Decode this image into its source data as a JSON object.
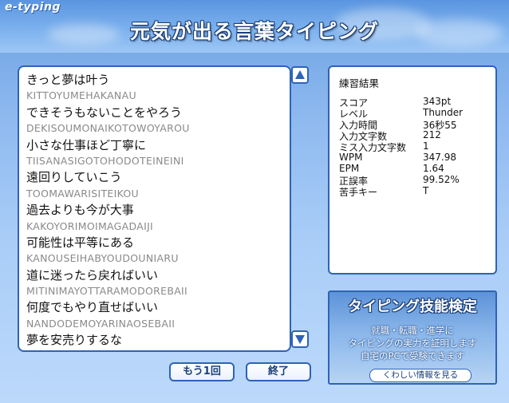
{
  "app": {
    "logo": "e-typing",
    "title": "元気が出る言葉タイピング"
  },
  "text_lines": [
    {
      "jp": "きっと夢は叶う",
      "romaji": "KITTOYUMEHAKANAU"
    },
    {
      "jp": "できそうもないことをやろう",
      "romaji": "DEKISOUMONAIKOTOWOYAROU"
    },
    {
      "jp": "小さな仕事ほど丁寧に",
      "romaji": "TIISANASIGOTOHODOTEINEINI"
    },
    {
      "jp": "遠回りしていこう",
      "romaji": "TOOMAWARISITEIKOU"
    },
    {
      "jp": "過去よりも今が大事",
      "romaji": "KAKOYORIMOIMAGADAIJI"
    },
    {
      "jp": "可能性は平等にある",
      "romaji": "KANOUSEIHABYOUDOUNIARU"
    },
    {
      "jp": "道に迷ったら戻ればいい",
      "romaji": "MITINIMAYOTTARAMODOREBAII"
    },
    {
      "jp": "何度でもやり直せばいい",
      "romaji": "NANDODEMOYARINAOSEBAII"
    },
    {
      "jp": "夢を安売りするな",
      "romaji": ""
    }
  ],
  "results": {
    "title": "練習結果",
    "rows": [
      {
        "label": "スコア",
        "value": "343pt"
      },
      {
        "label": "レベル",
        "value": "Thunder"
      },
      {
        "label": "入力時間",
        "value": "36秒55"
      },
      {
        "label": "入力文字数",
        "value": "212"
      },
      {
        "label": "ミス入力文字数",
        "value": "1"
      },
      {
        "label": "WPM",
        "value": "347.98"
      },
      {
        "label": "EPM",
        "value": "1.64"
      },
      {
        "label": "正誤率",
        "value": "99.52%"
      },
      {
        "label": "苦手キー",
        "value": "T"
      }
    ]
  },
  "ad": {
    "title": "タイピング技能検定",
    "lines": [
      "就職・転職・進学に",
      "タイピングの実力を証明します",
      "自宅のPCで受験できます"
    ],
    "button": "くわしい情報を見る"
  },
  "buttons": {
    "retry": "もう1回",
    "end": "終了"
  },
  "colors": {
    "accent_border": "#2e63b8",
    "header_blue": "#5a95e0",
    "button_text": "#1b3f78"
  }
}
